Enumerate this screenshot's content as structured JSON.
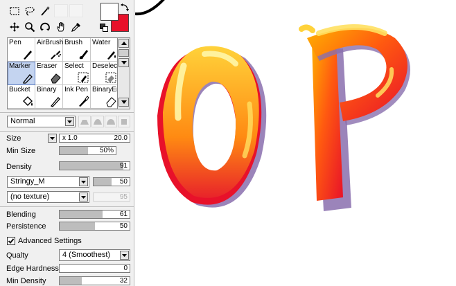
{
  "tools": [
    {
      "name": "rect-select-tool",
      "icon": "dashed-rectangle-icon"
    },
    {
      "name": "lasso-tool",
      "icon": "lasso-icon"
    },
    {
      "name": "magic-wand-tool",
      "icon": "magic-wand-icon"
    },
    {
      "name": "move-tool",
      "icon": "move-arrows-icon"
    },
    {
      "name": "zoom-tool",
      "icon": "magnifier-icon"
    },
    {
      "name": "rotate-tool",
      "icon": "rotate-icon"
    },
    {
      "name": "hand-tool",
      "icon": "hand-icon"
    },
    {
      "name": "eyedropper-tool",
      "icon": "eyedropper-icon"
    }
  ],
  "colors": {
    "primary": "#ffffff",
    "secondary": "#e8112a"
  },
  "brushes": [
    {
      "label": "Pen",
      "icon": "pen-icon"
    },
    {
      "label": "AirBrush",
      "icon": "airbrush-icon"
    },
    {
      "label": "Brush",
      "icon": "brush-icon"
    },
    {
      "label": "Water",
      "icon": "water-icon"
    },
    {
      "label": "Marker",
      "icon": "marker-icon",
      "selected": true
    },
    {
      "label": "Eraser",
      "icon": "eraser-icon"
    },
    {
      "label": "Select",
      "icon": "select-brush-icon"
    },
    {
      "label": "Deselect",
      "icon": "deselect-brush-icon"
    },
    {
      "label": "Bucket",
      "icon": "bucket-icon"
    },
    {
      "label": "Binary",
      "icon": "binary-pen-icon"
    },
    {
      "label": "Ink Pen",
      "icon": "ink-pen-icon"
    },
    {
      "label": "BinaryEr",
      "icon": "binary-eraser-icon"
    }
  ],
  "blend_mode": "Normal",
  "size": {
    "label": "Size",
    "multiplier": "x 1.0",
    "value": "20.0"
  },
  "min_size": {
    "label": "Min Size",
    "value": "50%",
    "fill_percent": 50
  },
  "density": {
    "label": "Density",
    "value": "91",
    "fill_percent": 91
  },
  "stroke_texture": {
    "name": "Stringy_M",
    "value": "50",
    "fill_percent": 50
  },
  "paper_texture": {
    "name": "(no texture)",
    "value": "95",
    "fill_percent": 95
  },
  "blending": {
    "label": "Blending",
    "value": "61",
    "fill_percent": 61
  },
  "persistence": {
    "label": "Persistence",
    "value": "50",
    "fill_percent": 50
  },
  "advanced_settings": {
    "label": "Advanced Settings",
    "checked": true
  },
  "quality": {
    "label": "Qualty",
    "value": "4 (Smoothest)"
  },
  "edge_hardness": {
    "label": "Edge Hardness",
    "value": "0",
    "fill_percent": 0
  },
  "min_density": {
    "label": "Min Density",
    "value": "32",
    "fill_percent": 32
  }
}
